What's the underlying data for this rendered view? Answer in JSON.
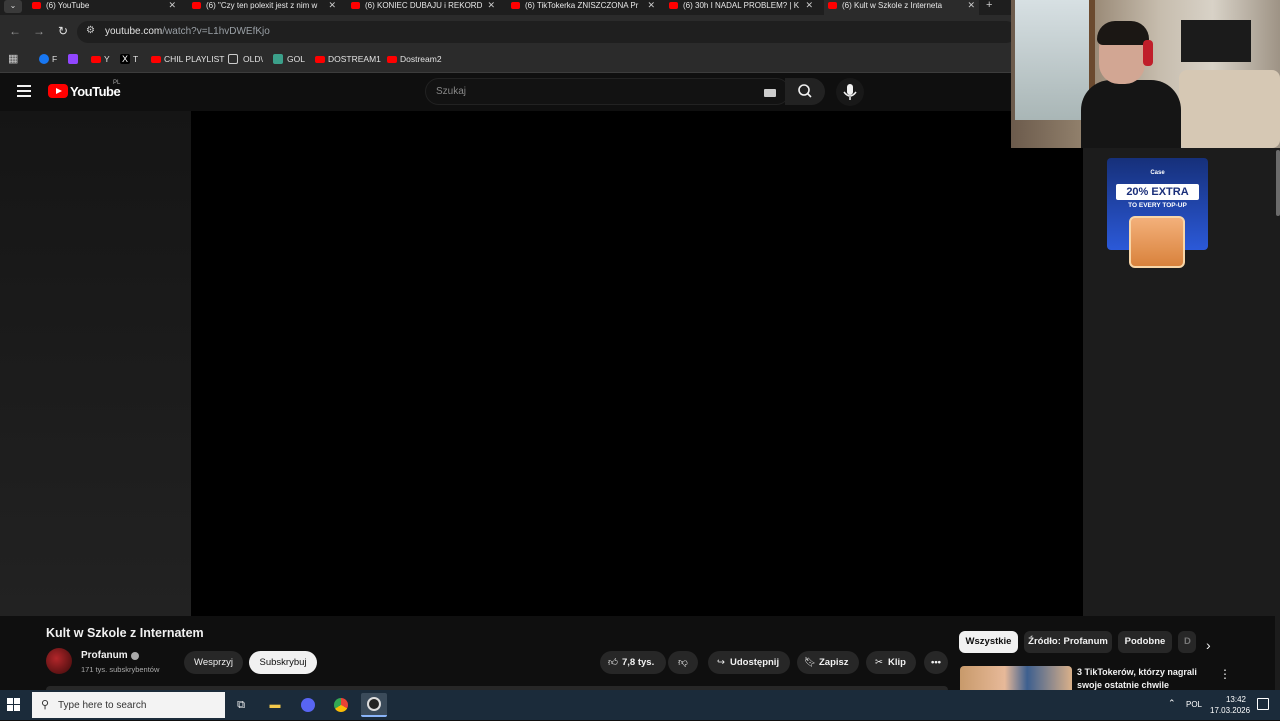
{
  "browser": {
    "tabs": [
      {
        "title": "(6) YouTube",
        "active": false
      },
      {
        "title": "(6) \"Czy ten polexit jest z nim w",
        "active": false
      },
      {
        "title": "(6) KONIEC DUBAJU i REKORD",
        "active": false
      },
      {
        "title": "(6) TikTokerka ZNISZCZONA Pr",
        "active": false
      },
      {
        "title": "(6) 30h I NADAL PROBLEM? | K",
        "active": false
      },
      {
        "title": "(6) Kult w Szkole z Interneta",
        "active": true
      }
    ],
    "tab_menu_icon": "chevron-down-icon",
    "new_tab": "+",
    "url_host": "youtube.com",
    "url_path": "/watch?v=L1hvDWEfKjo",
    "bookmarks": [
      {
        "label": "F",
        "icon_color": "#1877f2"
      },
      {
        "label": "",
        "icon_color": "#9146ff"
      },
      {
        "label": "Y",
        "icon_color": "#ff0000"
      },
      {
        "label": "T",
        "icon_color": "#000000"
      },
      {
        "label": "CHIL PLAYLIST",
        "icon_color": "#ff0000"
      },
      {
        "label": "OLD\\",
        "icon_color": "#2b2b2b"
      },
      {
        "label": "GOL",
        "icon_color": "#3ba08a"
      },
      {
        "label": "DOSTREAM1",
        "icon_color": "#ff0000"
      },
      {
        "label": "Dostream2",
        "icon_color": "#ff0000"
      }
    ]
  },
  "youtube": {
    "logo_text": "YouTube",
    "country_code": "PL",
    "search_placeholder": "Szukaj",
    "video": {
      "title": "Kult w Szkole z Internatem",
      "channel": "Profanum",
      "subscribers": "171 tys. subskrybentów",
      "support_label": "Wesprzyj",
      "subscribe_label": "Subskrybuj",
      "likes": "7,8 tys.",
      "share_label": "Udostępnij",
      "save_label": "Zapisz",
      "clip_label": "Klip"
    },
    "chips": [
      "Wszystkie",
      "Źródło: Profanum",
      "Podobne",
      "D"
    ],
    "recommended": [
      {
        "title": "3 TikTokerów, którzy nagrali swoje ostatnie chwile"
      }
    ]
  },
  "ad": {
    "brand": "Case",
    "headline": "20% EXTRA",
    "subline": "TO EVERY TOP-UP",
    "colors": {
      "background": "#2b59d8"
    }
  },
  "taskbar": {
    "search_placeholder": "Type here to search",
    "language": "POL",
    "time": "13:42",
    "date": "17.03.2026"
  }
}
